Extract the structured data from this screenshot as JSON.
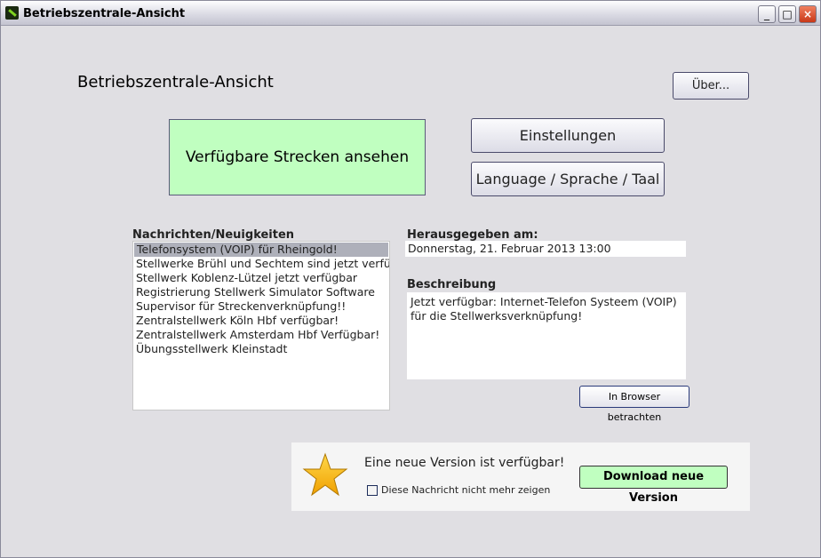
{
  "window": {
    "title": "Betriebszentrale-Ansicht"
  },
  "header": {
    "title": "Betriebszentrale-Ansicht",
    "about_label": "Über..."
  },
  "buttons": {
    "routes": "Verfügbare Strecken ansehen",
    "settings": "Einstellungen",
    "language": "Language / Sprache / Taal"
  },
  "news": {
    "label": "Nachrichten/Neuigkeiten",
    "items": [
      "Telefonsystem (VOIP) für Rheingold!",
      "Stellwerke Brühl und Sechtem sind jetzt verfügbar",
      "Stellwerk Koblenz-Lützel jetzt verfügbar",
      "Registrierung Stellwerk Simulator Software",
      "Supervisor für Streckenverknüpfung!!",
      "Zentralstellwerk Köln Hbf verfügbar!",
      "Zentralstellwerk Amsterdam Hbf Verfügbar!",
      "Übungsstellwerk Kleinstadt"
    ]
  },
  "details": {
    "published_label": "Herausgegeben am:",
    "published_value": "Donnerstag, 21. Februar 2013 13:00",
    "description_label": "Beschreibung",
    "description": "Jetzt verfügbar: Internet-Telefon Systeem (VOIP) für die Stellwerksverknüpfung!",
    "browser_button": "In Browser betrachten"
  },
  "update": {
    "message": "Eine neue Version ist verfügbar!",
    "checkbox_label": "Diese Nachricht nicht mehr zeigen",
    "download_button": "Download neue Version"
  }
}
